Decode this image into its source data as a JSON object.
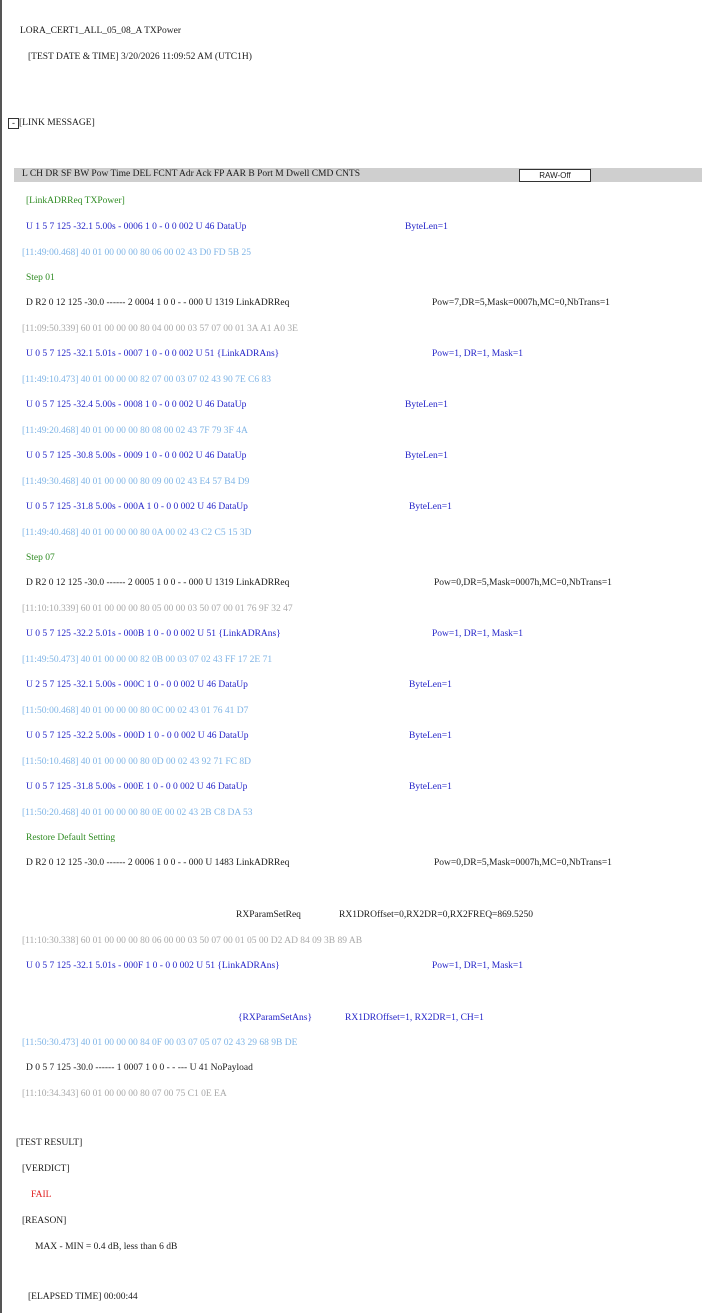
{
  "test_name": "LORA_CERT1_ALL_05_08_A TXPower",
  "test_datetime": "[TEST DATE & TIME] 3/20/2026 11:09:52 AM (UTC1H)",
  "link_section": {
    "toggle": "-",
    "label": "[LINK MESSAGE]"
  },
  "header": {
    "columns": "L CH DR SF  BW    Pow  Time  DEL FCNT Adr Ack FP AAR B Port M   Dwell   CMD     CNTS",
    "raw_button": "RAW-Off"
  },
  "lines": [
    {
      "text": "[LinkADRReq TXPower]",
      "style": "green"
    },
    {
      "text": "U  1  5  7  125  -32.1  5.00s -  0006  1  0    -   0 0  002 U    46  DataUp",
      "detail": "ByteLen=1",
      "style": "blue"
    },
    {
      "text": "[11:49:00.468] 40 01 00 00 00 80 06 00 02 43 D0 FD 5B 25",
      "style": "lightblue"
    },
    {
      "text": "Step 01",
      "style": "green"
    },
    {
      "text": "D R2  0 12  125  -30.0 ------ 2  0004  1  0    0   - -  000 U   1319  LinkADRReq",
      "detail": "Pow=7,DR=5,Mask=0007h,MC=0,NbTrans=1",
      "style": "dark"
    },
    {
      "text": "[11:09:50.339] 60 01 00 00 00 80 04 00 00 03 57 07 00 01 3A A1 A0 3E",
      "style": "gray"
    },
    {
      "text": "U  0  5  7  125  -32.1  5.01s -  0007  1  0    -   0 0  002 U    51  {LinkADRAns}",
      "detail": "Pow=1, DR=1, Mask=1",
      "style": "blue"
    },
    {
      "text": "[11:49:10.473] 40 01 00 00 00 82 07 00 03 07 02 43 90 7E C6 83",
      "style": "lightblue"
    },
    {
      "text": "U  0  5  7  125  -32.4  5.00s -  0008  1  0    -   0 0  002 U    46  DataUp",
      "detail": "ByteLen=1",
      "style": "blue"
    },
    {
      "text": "[11:49:20.468] 40 01 00 00 00 80 08 00 02 43 7F 79 3F 4A",
      "style": "lightblue"
    },
    {
      "text": "U  0  5  7  125  -30.8  5.00s -  0009  1  0    -   0 0  002 U    46  DataUp",
      "detail": "ByteLen=1",
      "style": "blue"
    },
    {
      "text": "[11:49:30.468] 40 01 00 00 00 80 09 00 02 43 E4 57 B4 D9",
      "style": "lightblue"
    },
    {
      "text": "U  0  5  7  125  -31.8  5.00s -  000A  1  0    -   0 0  002 U    46  DataUp",
      "detail": "ByteLen=1",
      "style": "blue"
    },
    {
      "text": "[11:49:40.468] 40 01 00 00 00 80 0A 00 02 43 C2 C5 15 3D",
      "style": "lightblue"
    },
    {
      "text": "Step 07",
      "style": "green"
    },
    {
      "text": "D R2  0 12  125  -30.0 ------ 2  0005  1  0    0   - -  000 U   1319  LinkADRReq",
      "detail": "Pow=0,DR=5,Mask=0007h,MC=0,NbTrans=1",
      "style": "dark"
    },
    {
      "text": "[11:10:10.339] 60 01 00 00 00 80 05 00 00 03 50 07 00 01 76 9F 32 47",
      "style": "gray"
    },
    {
      "text": "U  0  5  7  125  -32.2  5.01s -  000B  1  0    -   0 0  002 U    51  {LinkADRAns}",
      "detail": "Pow=1, DR=1, Mask=1",
      "style": "blue"
    },
    {
      "text": "[11:49:50.473] 40 01 00 00 00 82 0B 00 03 07 02 43 FF 17 2E 71",
      "style": "lightblue"
    },
    {
      "text": "U  2  5  7  125  -32.1  5.00s -  000C  1  0    -   0 0  002 U    46  DataUp",
      "detail": "ByteLen=1",
      "style": "blue"
    },
    {
      "text": "[11:50:00.468] 40 01 00 00 00 80 0C 00 02 43 01 76 41 D7",
      "style": "lightblue"
    },
    {
      "text": "U  0  5  7  125  -32.2  5.00s -  000D  1  0    -   0 0  002 U    46  DataUp",
      "detail": "ByteLen=1",
      "style": "blue"
    },
    {
      "text": "[11:50:10.468] 40 01 00 00 00 80 0D 00 02 43 92 71 FC 8D",
      "style": "lightblue"
    },
    {
      "text": "U  0  5  7  125  -31.8  5.00s -  000E  1  0    -   0 0  002 U    46  DataUp",
      "detail": "ByteLen=1",
      "style": "blue"
    },
    {
      "text": "[11:50:20.468] 40 01 00 00 00 80 0E 00 02 43 2B C8 DA 53",
      "style": "lightblue"
    },
    {
      "text": "Restore Default Setting",
      "style": "green"
    },
    {
      "text": "D R2  0 12  125  -30.0 ------ 2  0006  1  0    0   - -  000 U   1483  LinkADRReq",
      "detail": "Pow=0,DR=5,Mask=0007h,MC=0,NbTrans=1",
      "style": "dark"
    },
    {
      "text": "RXParamSetReq",
      "detail": "RX1DROffset=0,RX2DR=0,RX2FREQ=869.5250",
      "style": "dark"
    },
    {
      "text": "[11:10:30.338] 60 01 00 00 00 80 06 00 00 03 50 07 00 01 05 00 D2 AD 84 09 3B 89 AB",
      "style": "gray"
    },
    {
      "text": "U  0  5  7  125  -32.1  5.01s -  000F  1  0    -   0 0  002 U    51  {LinkADRAns}",
      "detail": "Pow=1, DR=1, Mask=1",
      "style": "blue"
    },
    {
      "text": "{RXParamSetAns}",
      "detail": "RX1DROffset=1, RX2DR=1, CH=1",
      "style": "blue"
    },
    {
      "text": "[11:50:30.473] 40 01 00 00 00 84 0F 00 03 07 05 07 02 43 29 68 9B DE",
      "style": "lightblue"
    },
    {
      "text": "D  0  5  7  125  -30.0 ------ 1  0007  1  0    0   - -  --- U    41  NoPayload",
      "style": "dark"
    },
    {
      "text": "[11:10:34.343] 60 01 00 00 00 80 07 00 75 C1 0E EA",
      "style": "gray"
    }
  ],
  "result": {
    "title": "[TEST RESULT]",
    "verdict_label": "[VERDICT]",
    "verdict": "FAIL",
    "reason_label": "[REASON]",
    "reason": "MAX - MIN = 0.4 dB, less than 6 dB",
    "elapsed": "[ELAPSED TIME] 00:00:44"
  }
}
